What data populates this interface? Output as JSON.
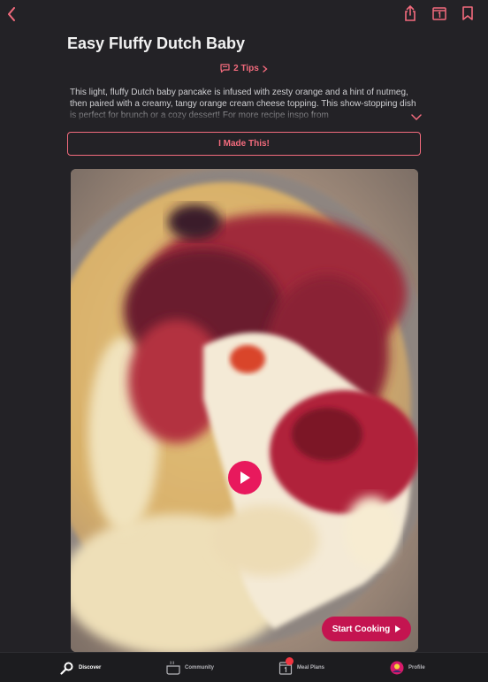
{
  "recipe": {
    "title": "Easy Fluffy Dutch Baby",
    "tips_label": "2 Tips",
    "description": "This light, fluffy Dutch baby pancake is infused with zesty orange and a hint of nutmeg, then paired with a creamy, tangy orange cream cheese topping. This show-stopping dish is perfect for brunch or a cozy dessert! For more recipe inspo from",
    "made_this_label": "I Made This!",
    "start_cooking_label": "Start Cooking"
  },
  "tabs": [
    {
      "label": "Discover",
      "icon": "search-icon",
      "active": true
    },
    {
      "label": "Community",
      "icon": "community-pot-icon",
      "active": false
    },
    {
      "label": "Meal Plans",
      "icon": "calendar-icon",
      "active": false
    },
    {
      "label": "Profile",
      "icon": "avatar-icon",
      "active": false
    }
  ],
  "colors": {
    "accent": "#f36b7d",
    "brand": "#e8195d",
    "background": "#232226",
    "tabbar": "#1c1c1f"
  },
  "icons": {
    "back": "chevron-left-icon",
    "share": "share-icon",
    "calendar": "calendar-icon",
    "bookmark": "bookmark-icon",
    "tips": "comment-icon",
    "expand": "chevron-down-icon",
    "play": "play-icon"
  }
}
